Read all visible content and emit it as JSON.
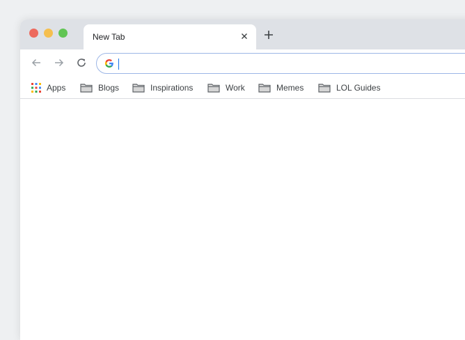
{
  "window": {
    "traffic_lights": [
      "close",
      "minimize",
      "zoom"
    ]
  },
  "tab": {
    "title": "New Tab",
    "close_icon": "close-icon",
    "new_tab_icon": "plus-icon"
  },
  "toolbar": {
    "back_icon": "arrow-left-icon",
    "forward_icon": "arrow-right-icon",
    "reload_icon": "reload-icon",
    "omnibox_value": "",
    "omnibox_icon": "google-g-icon"
  },
  "bookmarks": {
    "apps_label": "Apps",
    "items": [
      {
        "label": "Blogs",
        "icon": "folder-icon"
      },
      {
        "label": "Inspirations",
        "icon": "folder-icon"
      },
      {
        "label": "Work",
        "icon": "folder-icon"
      },
      {
        "label": "Memes",
        "icon": "folder-icon"
      },
      {
        "label": "LOL Guides",
        "icon": "folder-icon"
      }
    ]
  },
  "colors": {
    "titlebar": "#dee1e6",
    "close": "#ed6a5e",
    "minimize": "#f5bf4f",
    "zoom": "#61c554",
    "omnibox_border": "#9cb6e6"
  }
}
